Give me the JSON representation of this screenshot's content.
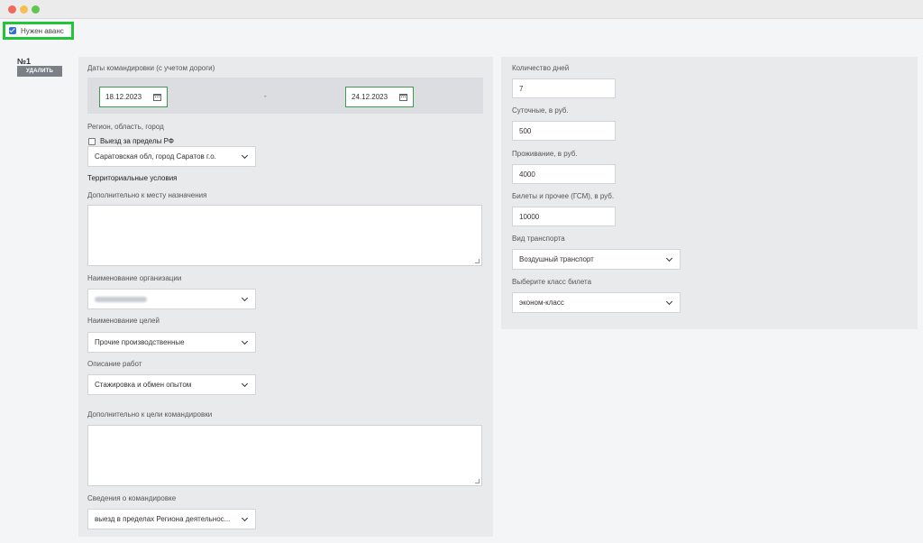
{
  "advance": {
    "label": "Нужен аванс",
    "checked": true
  },
  "trip": {
    "number": "№1",
    "delete_label": "УДАЛИТЬ",
    "dates": {
      "label": "Даты командировки (с учетом дороги)",
      "start": "18.12.2023",
      "separator": "-",
      "end": "24.12.2023"
    },
    "region": {
      "label": "Регион, область, город",
      "abroad_label": "Выезд за пределы РФ",
      "abroad_checked": false,
      "value": "Саратовская обл, город Саратов г.о."
    },
    "territorial": {
      "heading": "Территориальные условия",
      "extra_label": "Дополнительно к месту назначения",
      "extra_value": ""
    },
    "organization": {
      "label": "Наименование организации"
    },
    "goals": {
      "label": "Наименование целей",
      "value": "Прочие производственные"
    },
    "work": {
      "label": "Описание работ",
      "value": "Стажировка и обмен опытом"
    },
    "purpose_extra": {
      "label": "Дополнительно к цели командировки",
      "value": ""
    },
    "info": {
      "label": "Сведения о командировке",
      "value": "выезд в пределах Региона деятельнос..."
    }
  },
  "costs": {
    "days": {
      "label": "Количество дней",
      "value": "7"
    },
    "daily": {
      "label": "Суточные, в руб.",
      "value": "500"
    },
    "living": {
      "label": "Проживание, в руб.",
      "value": "4000"
    },
    "tickets": {
      "label": "Билеты и прочее (ГСМ), в руб.",
      "value": "10000"
    },
    "transport": {
      "label": "Вид транспорта",
      "value": "Воздушный транспорт"
    },
    "ticket_class": {
      "label": "Выберите класс билета",
      "value": "эконом-класс"
    }
  }
}
